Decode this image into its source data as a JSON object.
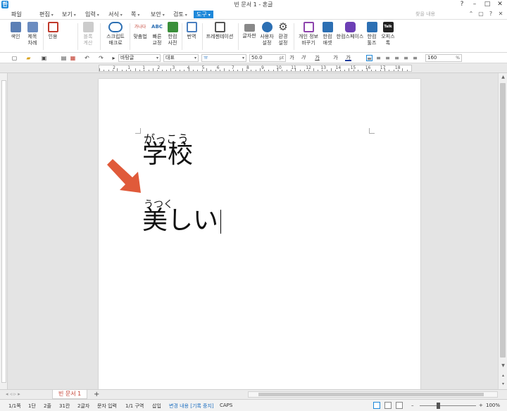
{
  "window": {
    "app_icon": "한",
    "title": "빈 문서 1 - 혼글",
    "controls": [
      "?",
      "–",
      "□",
      "✕"
    ]
  },
  "menu": {
    "items": [
      {
        "label": "파일",
        "has_arrow": false
      },
      {
        "label": "편집",
        "has_arrow": true
      },
      {
        "label": "보기",
        "has_arrow": true
      },
      {
        "label": "입력",
        "has_arrow": true
      },
      {
        "label": "서식",
        "has_arrow": true
      },
      {
        "label": "쪽",
        "has_arrow": true
      },
      {
        "label": "보안",
        "has_arrow": true
      },
      {
        "label": "검토",
        "has_arrow": true
      },
      {
        "label": "도구",
        "has_arrow": true,
        "active": true
      }
    ],
    "search_placeholder": "찾을 내용",
    "right_icons": [
      "⌃",
      "▢",
      "?",
      "✕"
    ]
  },
  "ribbon": {
    "buttons": [
      {
        "label": "색인",
        "sub": "",
        "icon": "index-icon",
        "color": "#5b7fb5"
      },
      {
        "label": "제목",
        "sub": "차례",
        "icon": "toc-icon",
        "color": "#6b8cc0"
      },
      {
        "label": "인용",
        "sub": "",
        "icon": "citation-icon",
        "color": "#c0392b"
      },
      {
        "label": "블록",
        "sub": "계산",
        "icon": "block-calc-icon",
        "color": "#bbbbbb",
        "disabled": true
      },
      {
        "label": "스크립트",
        "sub": "매크로",
        "icon": "script-macro-icon",
        "color": "#2c6fb3"
      },
      {
        "label": "맞춤법",
        "sub": "",
        "icon": "spellcheck-icon",
        "color": "#c0392b"
      },
      {
        "label": "빠른",
        "sub": "교정",
        "icon": "quick-correct-icon",
        "color": "#2c6fb3"
      },
      {
        "label": "한컴",
        "sub": "사전",
        "icon": "dictionary-icon",
        "color": "#3a8f3a"
      },
      {
        "label": "번역",
        "sub": "",
        "icon": "translate-icon",
        "color": "#4a7fc0"
      },
      {
        "label": "프레젠테이션",
        "sub": "",
        "icon": "presentation-icon",
        "color": "#555555"
      },
      {
        "label": "글자판",
        "sub": "",
        "icon": "keyboard-icon",
        "color": "#666666"
      },
      {
        "label": "사용자",
        "sub": "설정",
        "icon": "user-settings-icon",
        "color": "#2c6fb3"
      },
      {
        "label": "환경",
        "sub": "설정",
        "icon": "gear-icon",
        "color": "#444444"
      },
      {
        "label": "개인 정보",
        "sub": "바꾸기",
        "icon": "privacy-icon",
        "color": "#8e44ad"
      },
      {
        "label": "한컴",
        "sub": "애셋",
        "icon": "hancom-asset-icon",
        "color": "#2c6fb3"
      },
      {
        "label": "한컴스페이스",
        "sub": "",
        "icon": "hancom-space-icon",
        "color": "#6c3fb5"
      },
      {
        "label": "한컴",
        "sub": "툴즈",
        "icon": "hancom-tools-icon",
        "color": "#2c6fb3"
      },
      {
        "label": "오피스",
        "sub": "톡",
        "icon": "office-talk-icon",
        "color": "#222222"
      }
    ],
    "icon_glyphs": {
      "spellcheck": "가나다",
      "quick_correct": "ABC",
      "office_talk": "Talk"
    }
  },
  "format_bar": {
    "style_value": "바탕글",
    "font_kind": "대표",
    "font_value": "ㅠ",
    "size_value": "50.0",
    "size_unit": "pt",
    "zoom_value": "160",
    "zoom_unit": "%",
    "format_glyphs": [
      "가",
      "가",
      "가",
      "가",
      "가"
    ]
  },
  "ruler": {
    "numbers": [
      "2",
      "1",
      "1",
      "2",
      "3",
      "4",
      "5",
      "6",
      "7",
      "8",
      "9",
      "10",
      "11",
      "12",
      "13",
      "14",
      "15",
      "16",
      "17",
      "18"
    ]
  },
  "document": {
    "lines": [
      {
        "furigana": "がっこう",
        "text": "学校"
      },
      {
        "furigana": "うつく",
        "text": "美しい"
      }
    ],
    "arrow_color": "#e05a3a"
  },
  "tabs": {
    "nav": "◂ ◃ ▹ ▸",
    "active_tab": "빈 문서 1",
    "add_tab": "+"
  },
  "status": {
    "page": "1/1쪽",
    "column": "1단",
    "line": "2줄",
    "col": "31칸",
    "chars": "2글자",
    "mode": "문자 입력",
    "section": "1/1 구역",
    "insert": "삽입",
    "track_changes": "변경 내용 [기록 중지]",
    "caps": "CAPS",
    "zoom": "100%",
    "zoom_fraction": 0.33
  }
}
